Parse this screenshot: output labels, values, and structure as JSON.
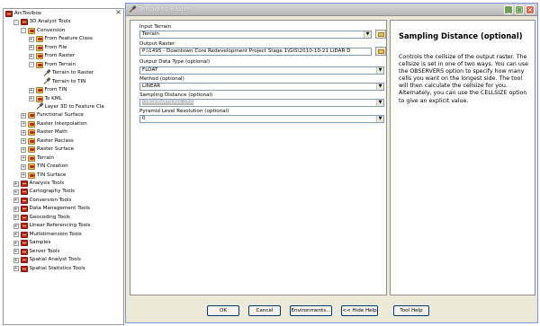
{
  "toolbox": {
    "close_glyph": "×",
    "tree": [
      {
        "label": "ArcToolbox",
        "level": 0,
        "icon": "toolbox-root-icon",
        "expander": "none"
      },
      {
        "label": "3D Analyst Tools",
        "level": 1,
        "icon": "toolbox-icon",
        "expander": "-"
      },
      {
        "label": "Conversion",
        "level": 2,
        "icon": "toolset-icon",
        "expander": "-"
      },
      {
        "label": "From Feature Class",
        "level": 3,
        "icon": "toolset-icon",
        "expander": "+"
      },
      {
        "label": "From File",
        "level": 3,
        "icon": "toolset-icon",
        "expander": "+"
      },
      {
        "label": "From Raster",
        "level": 3,
        "icon": "toolset-icon",
        "expander": "+"
      },
      {
        "label": "From Terrain",
        "level": 3,
        "icon": "toolset-icon",
        "expander": "-"
      },
      {
        "label": "Terrain to Raster",
        "level": 4,
        "icon": "hammer-icon",
        "expander": "none"
      },
      {
        "label": "Terrain to TIN",
        "level": 4,
        "icon": "hammer-icon",
        "expander": "none"
      },
      {
        "label": "From TIN",
        "level": 3,
        "icon": "toolset-icon",
        "expander": "+"
      },
      {
        "label": "To KML",
        "level": 3,
        "icon": "toolset-icon",
        "expander": "+"
      },
      {
        "label": "Layer 3D to Feature Cla",
        "level": 3,
        "icon": "hammer-icon",
        "expander": "none"
      },
      {
        "label": "Functional Surface",
        "level": 2,
        "icon": "toolset-icon",
        "expander": "+"
      },
      {
        "label": "Raster Interpolation",
        "level": 2,
        "icon": "toolset-icon",
        "expander": "+"
      },
      {
        "label": "Raster Math",
        "level": 2,
        "icon": "toolset-icon",
        "expander": "+"
      },
      {
        "label": "Raster Reclass",
        "level": 2,
        "icon": "toolset-icon",
        "expander": "+"
      },
      {
        "label": "Raster Surface",
        "level": 2,
        "icon": "toolset-icon",
        "expander": "+"
      },
      {
        "label": "Terrain",
        "level": 2,
        "icon": "toolset-icon",
        "expander": "+"
      },
      {
        "label": "TIN Creation",
        "level": 2,
        "icon": "toolset-icon",
        "expander": "+"
      },
      {
        "label": "TIN Surface",
        "level": 2,
        "icon": "toolset-icon",
        "expander": "+"
      },
      {
        "label": "Analysis Tools",
        "level": 1,
        "icon": "toolbox-icon",
        "expander": "+"
      },
      {
        "label": "Cartography Tools",
        "level": 1,
        "icon": "toolbox-icon",
        "expander": "+"
      },
      {
        "label": "Conversion Tools",
        "level": 1,
        "icon": "toolbox-icon",
        "expander": "+"
      },
      {
        "label": "Data Management Tools",
        "level": 1,
        "icon": "toolbox-icon",
        "expander": "+"
      },
      {
        "label": "Geocoding Tools",
        "level": 1,
        "icon": "toolbox-icon",
        "expander": "+"
      },
      {
        "label": "Linear Referencing Tools",
        "level": 1,
        "icon": "toolbox-icon",
        "expander": "+"
      },
      {
        "label": "Multidimension Tools",
        "level": 1,
        "icon": "toolbox-icon",
        "expander": "+"
      },
      {
        "label": "Samples",
        "level": 1,
        "icon": "toolbox-icon",
        "expander": "+"
      },
      {
        "label": "Server Tools",
        "level": 1,
        "icon": "toolbox-icon",
        "expander": "+"
      },
      {
        "label": "Spatial Analyst Tools",
        "level": 1,
        "icon": "toolbox-icon",
        "expander": "+"
      },
      {
        "label": "Spatial Statistics Tools",
        "level": 1,
        "icon": "toolbox-icon",
        "expander": "+"
      }
    ]
  },
  "dialog": {
    "title": "Terrain to Raster",
    "window_buttons": {
      "minimize": "_",
      "maximize": "□",
      "close": "×"
    },
    "form": {
      "input_terrain": {
        "label": "Input Terrain",
        "value": "Terrain"
      },
      "output_raster": {
        "label": "Output Raster",
        "value": "P:\\1495 - Downtown Core Redevelopment Project Stage 1\\GIS\\2010-10-21 LiDAR D"
      },
      "output_data_type": {
        "label": "Output Data Type (optional)",
        "value": "FLOAT"
      },
      "method": {
        "label": "Method (optional)",
        "value": "LINEAR"
      },
      "sampling_distance": {
        "label": "Sampling Distance (optional)",
        "value": "OBSERVATIONS 250"
      },
      "pyramid_level": {
        "label": "Pyramid Level Resolution (optional)",
        "value": "0"
      }
    },
    "help": {
      "title": "Sampling Distance (optional)",
      "body": "Controls the cellsize of the output raster. The cellsize is set in one of two ways. You can use the OBSERVERS option to specify how many cells you want on the longest side. The tool will then calculate the cellsize for you. Alternately, you can use the CELLSIZE option to give an explicit value."
    },
    "buttons": {
      "ok": "OK",
      "cancel": "Cancel",
      "environments": "Environments...",
      "hide_help": "<< Hide Help",
      "tool_help": "Tool Help"
    }
  },
  "colors": {
    "error_red": "#c0261c",
    "toolset_gold": "#e8c86a",
    "dialog_face": "#ece9d8",
    "field_border": "#7f9db9"
  }
}
